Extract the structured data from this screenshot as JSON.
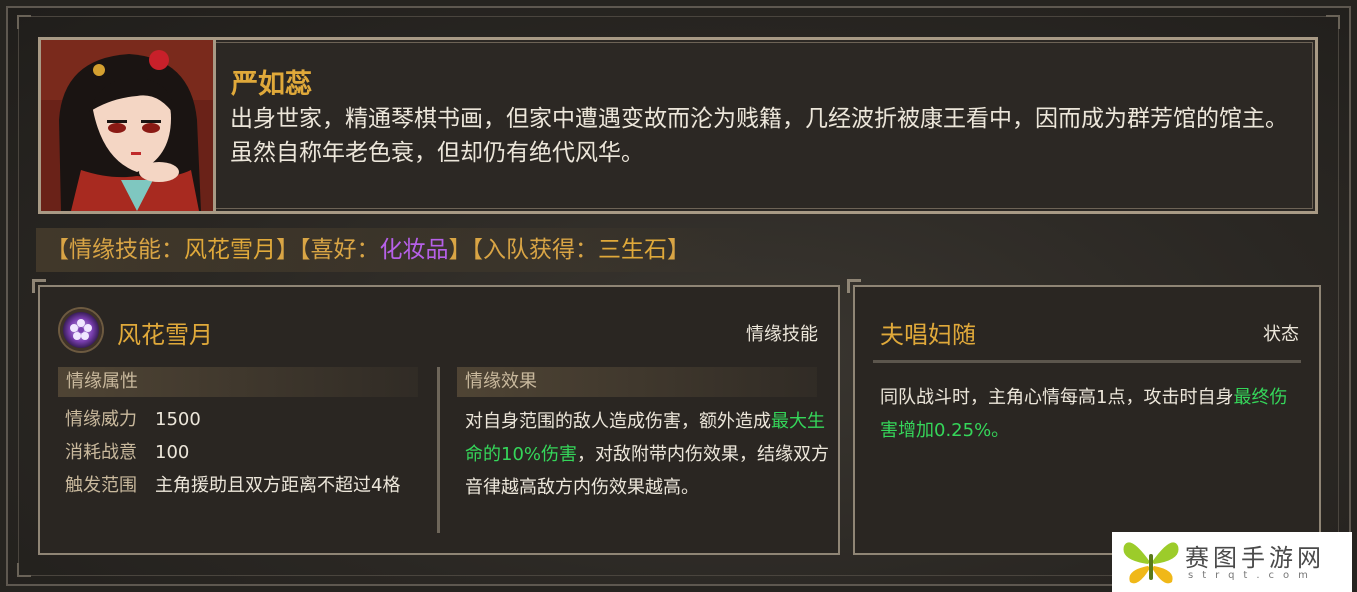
{
  "character": {
    "name": "严如蕊",
    "description": "出身世家，精通琴棋书画，但家中遭遇变故而沦为贱籍，几经波折被康王看中，因而成为群芳馆的馆主。虽然自称年老色衰，但却仍有绝代风华。"
  },
  "info_bar": {
    "open1": "【",
    "label_skill": "情缘技能：",
    "skill": "风花雪月",
    "close1": "】",
    "open2": "【",
    "label_hobby": "喜好：",
    "hobby": "化妆品",
    "close2": "】",
    "open3": "【",
    "label_join": "入队获得：",
    "join_item": "三生石",
    "close3": "】"
  },
  "skill_panel": {
    "icon": "flower-emblem-icon",
    "name": "风花雪月",
    "tag": "情缘技能",
    "attr_header": "情缘属性",
    "attributes": [
      {
        "key": "情缘威力",
        "value": "1500"
      },
      {
        "key": "消耗战意",
        "value": "100"
      },
      {
        "key": "触发范围",
        "value": "主角援助且双方距离不超过4格"
      }
    ],
    "effect_header": "情缘效果",
    "effect_part1": "对自身范围的敌人造成伤害，额外造成",
    "effect_highlight": "最大生命的10%伤害",
    "effect_part2": "，对敌附带内伤效果，结缘双方音律越高敌方内伤效果越高。"
  },
  "status_panel": {
    "name": "夫唱妇随",
    "tag": "状态",
    "text_part1": "同队战斗时，主角心情每高1点，攻击时自身",
    "text_highlight": "最终伤害增加0.25%。"
  },
  "watermark": {
    "text": "赛图手游网",
    "sub": "strqt.com"
  },
  "colors": {
    "accent_gold": "#e0a93a",
    "hobby_purple": "#b660e8",
    "highlight_green": "#35d65a",
    "border": "#a89a85"
  }
}
